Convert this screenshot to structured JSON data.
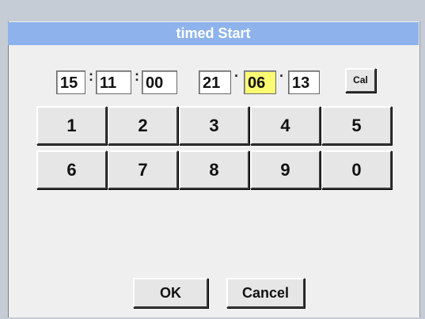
{
  "dialog": {
    "title": "timed Start"
  },
  "time": {
    "hours": "15",
    "minutes": "11",
    "seconds": "00",
    "separator": ":"
  },
  "date": {
    "day": "21",
    "month": "06",
    "year": "13",
    "separator": "·"
  },
  "calendar_button": {
    "label": "Cal"
  },
  "keypad": [
    "1",
    "2",
    "3",
    "4",
    "5",
    "6",
    "7",
    "8",
    "9",
    "0"
  ],
  "actions": {
    "ok_label": "OK",
    "cancel_label": "Cancel"
  },
  "colors": {
    "title_bar": "#8eb3ec",
    "active_field": "#fafa73",
    "field": "#ffffff",
    "button": "#e6e6e6"
  }
}
